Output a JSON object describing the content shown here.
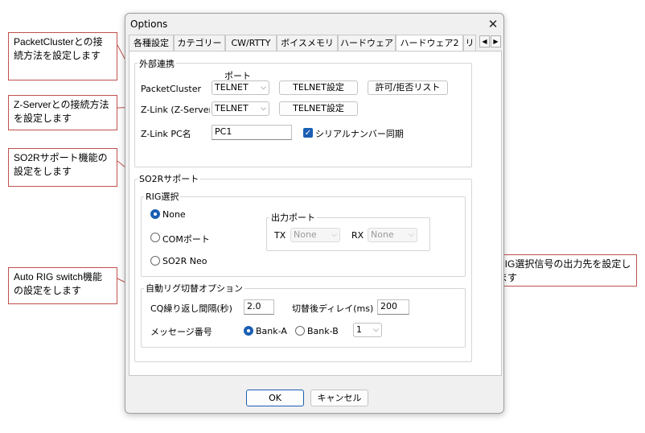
{
  "dialog": {
    "title": "Options",
    "tabs": [
      "各種設定",
      "カテゴリー",
      "CW/RTTY",
      "ボイスメモリ",
      "ハードウェア",
      "ハードウェア2",
      "リ"
    ],
    "active_tab": "ハードウェア2",
    "external": {
      "group_label": "外部連携",
      "port_header": "ポート",
      "packet_label": "PacketCluster",
      "packet_port": "TELNET",
      "telnet_button": "TELNET設定",
      "permit_button": "許可/拒否リスト",
      "zlink_label": "Z-Link (Z-Server)",
      "zlink_port": "TELNET",
      "zlink_telnet_button": "TELNET設定",
      "pc_label": "Z-Link PC名",
      "pc_value": "PC1",
      "serial_sync_label": "シリアルナンバー同期",
      "serial_sync_checked": true
    },
    "so2r": {
      "group_label": "SO2Rサポート",
      "rig_group_label": "RIG選択",
      "options": [
        "None",
        "COMポート",
        "SO2R Neo"
      ],
      "selected": "None",
      "output_group_label": "出力ポート",
      "tx_label": "TX",
      "tx_value": "None",
      "rx_label": "RX",
      "rx_value": "None"
    },
    "auto": {
      "group_label": "自動リグ切替オプション",
      "cq_label": "CQ繰り返し間隔(秒)",
      "cq_value": "2.0",
      "delay_label": "切替後ディレイ(ms)",
      "delay_value": "200",
      "msg_label": "メッセージ番号",
      "bank_a": "Bank-A",
      "bank_b": "Bank-B",
      "selected_bank": "Bank-A",
      "msg_number": "1"
    },
    "ok": "OK",
    "cancel": "キャンセル"
  },
  "callouts": {
    "packet": "PacketClusterとの接続方法を設定します",
    "zserver": "Z-Serverとの接続方法を設定します",
    "so2r": "SO2Rサポート機能の設定をします",
    "autorig": "Auto RIG switch機能の設定をします",
    "rigsignal": "RIG選択信号の出力先を設定します"
  },
  "colors": {
    "callout_border": "#c0504d",
    "accent": "#1a5fb4"
  }
}
